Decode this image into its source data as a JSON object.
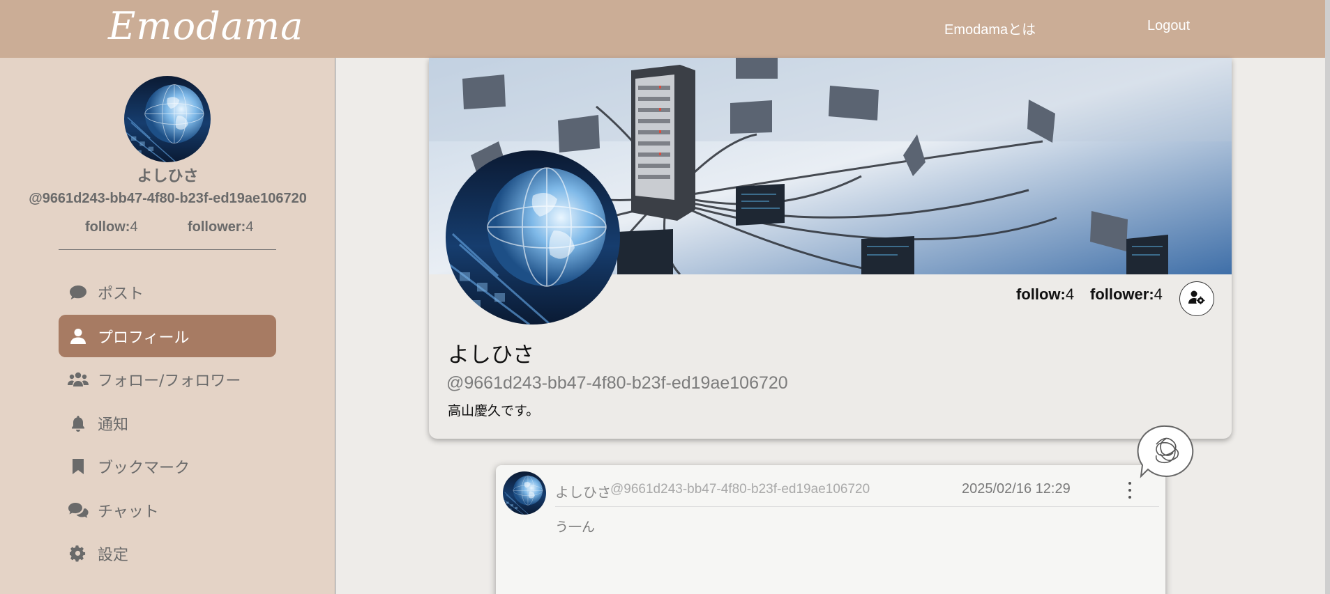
{
  "header": {
    "logo": "Emodama",
    "nav": {
      "about": "Emodamaとは",
      "logout": "Logout"
    },
    "background": "#cbad96"
  },
  "sidebar": {
    "user": {
      "name": "よしひさ",
      "handle": "@9661d243-bb47-4f80-b23f-ed19ae106720",
      "follow_label": "follow:",
      "follow_count": "4",
      "follower_label": "follower:",
      "follower_count": "4"
    },
    "menu": [
      {
        "label": "ポスト",
        "icon": "chat-bubble-icon",
        "active": false
      },
      {
        "label": "プロフィール",
        "icon": "user-icon",
        "active": true
      },
      {
        "label": "フォロー/フォロワー",
        "icon": "users-icon",
        "active": false
      },
      {
        "label": "通知",
        "icon": "bell-icon",
        "active": false
      },
      {
        "label": "ブックマーク",
        "icon": "bookmark-icon",
        "active": false
      },
      {
        "label": "チャット",
        "icon": "comments-icon",
        "active": false
      },
      {
        "label": "設定",
        "icon": "gear-icon",
        "active": false
      }
    ],
    "background": "#e4d3c6",
    "active_color": "#a77b63"
  },
  "profile": {
    "name": "よしひさ",
    "handle": "@9661d243-bb47-4f80-b23f-ed19ae106720",
    "bio": "高山慶久です。",
    "follow_label": "follow:",
    "follow_count": "4",
    "follower_label": "follower:",
    "follower_count": "4",
    "settings_icon": "user-gear-icon"
  },
  "post": {
    "author": "よしひさ",
    "handle": "@9661d243-bb47-4f80-b23f-ed19ae106720",
    "date": "2025/02/16 12:29",
    "body": "う一ん",
    "menu_icon": "vertical-ellipsis-icon",
    "emotion_icon": "tangled-scribble-speech-icon"
  }
}
